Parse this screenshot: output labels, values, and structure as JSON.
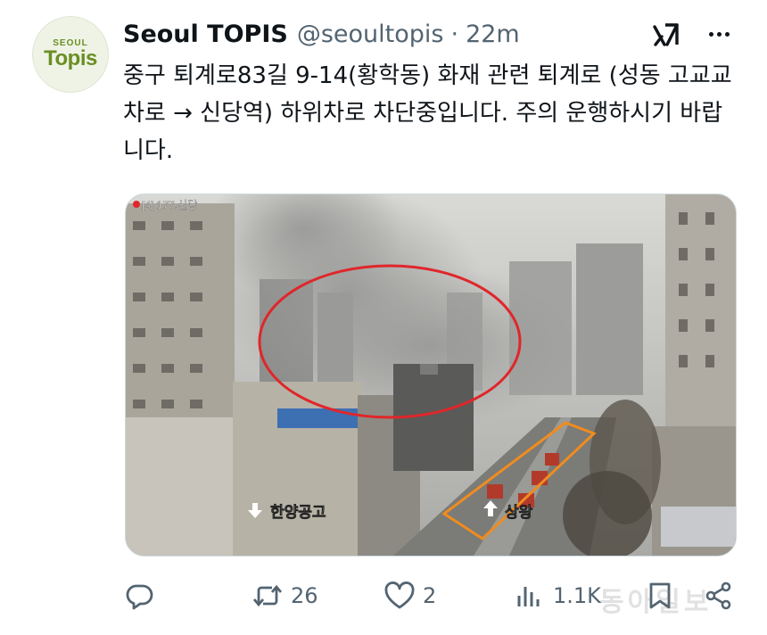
{
  "account": {
    "avatar_small": "SEOUL",
    "avatar_main": "Topis",
    "display_name": "Seoul TOPIS",
    "handle": "@seoultopis",
    "separator": "·",
    "time": "22m"
  },
  "tweet": {
    "text": "중구 퇴계로83길 9-14(황학동) 화재 관련 퇴계로 (성동 고교교차로 → 신당역) 하위차로 차단중입니다. 주의 운행하시기 바랍니다."
  },
  "media": {
    "camera_label": "[4] 177.신당",
    "label_left": "한양공고",
    "label_right": "상왕",
    "annotation_colors": {
      "fire_circle": "#e0262a",
      "lane_box": "#f08c1e"
    }
  },
  "metrics": {
    "retweets": "26",
    "likes": "2",
    "views": "1.1K"
  },
  "icons": {
    "grok": "grok-icon",
    "more": "more-icon",
    "reply": "reply-icon",
    "retweet": "retweet-icon",
    "like": "heart-icon",
    "views": "views-icon",
    "bookmark": "bookmark-icon",
    "share": "share-icon"
  },
  "watermark": "동아일보",
  "colors": {
    "text": "#0f1419",
    "secondary": "#536471",
    "brand_green": "#6b8e23"
  }
}
